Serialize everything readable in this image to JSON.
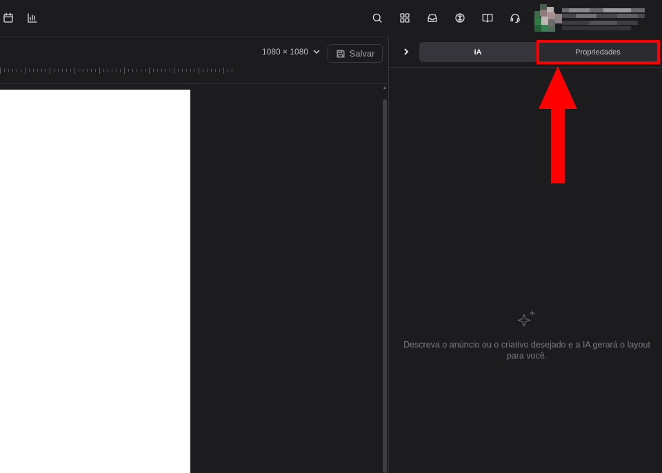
{
  "topbar": {
    "left_icons": [
      "calendar-icon",
      "bar-chart-icon"
    ],
    "right_icons": [
      "search-icon",
      "grid-icon",
      "inbox-icon",
      "brain-icon",
      "book-icon",
      "headset-icon"
    ]
  },
  "editor": {
    "size_label": "1080 × 1080",
    "save_label": "Salvar"
  },
  "panel": {
    "tabs": [
      {
        "label": "IA",
        "active": true
      },
      {
        "label": "Propriedades",
        "active": false
      }
    ],
    "empty_message": "Descreva o anúncio ou o criativo desejado e a IA gerará o layout para você."
  },
  "colors": {
    "background": "#1c1c1f",
    "highlight": "#ff0000",
    "artboard": "#ffffff"
  }
}
